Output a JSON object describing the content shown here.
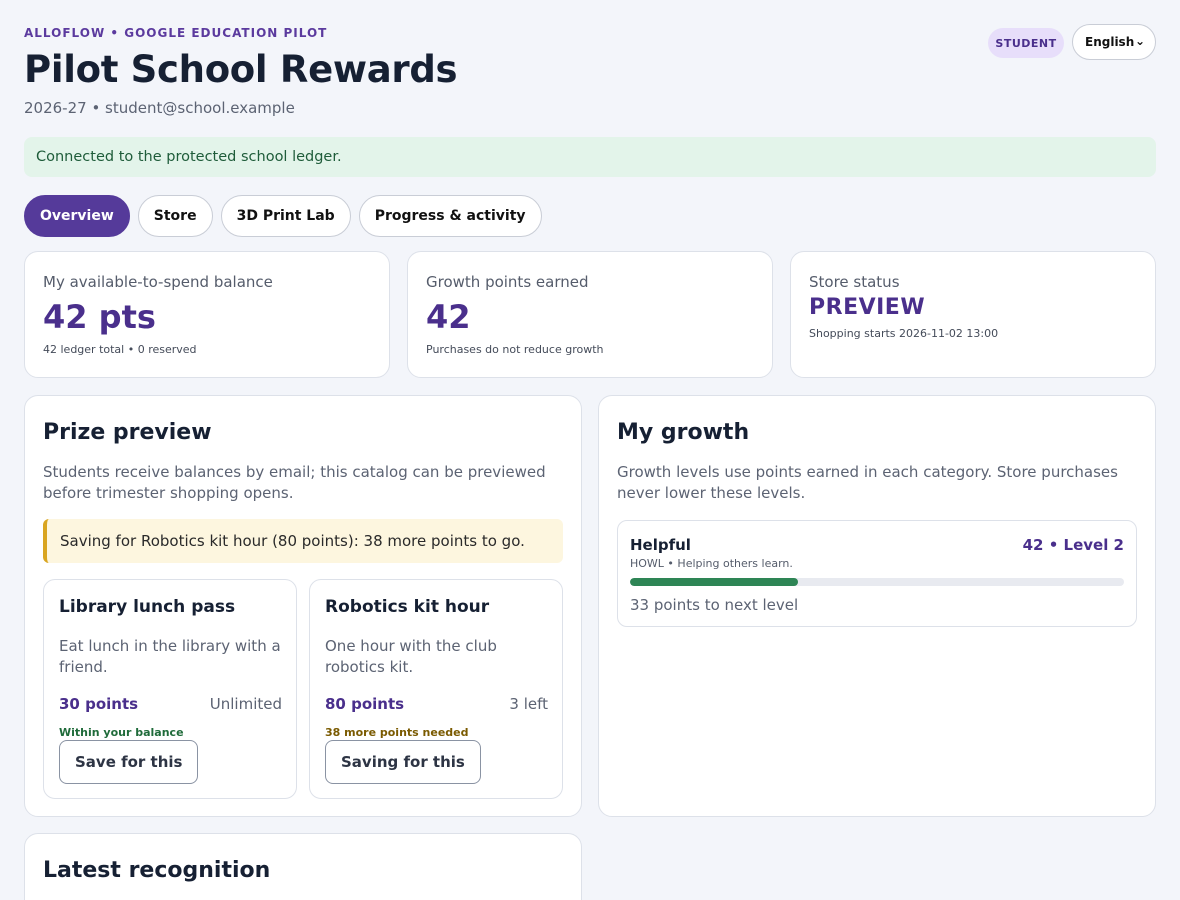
{
  "header": {
    "eyebrow": "ALLOFLOW • GOOGLE EDUCATION PILOT",
    "title": "Pilot School Rewards",
    "subtitle": "2026-27 • student@school.example",
    "role_badge": "STUDENT",
    "language": "English"
  },
  "notice": "Connected to the protected school ledger.",
  "tabs": [
    {
      "label": "Overview",
      "active": true
    },
    {
      "label": "Store",
      "active": false
    },
    {
      "label": "3D Print Lab",
      "active": false
    },
    {
      "label": "Progress & activity",
      "active": false
    }
  ],
  "stats": {
    "balance": {
      "label": "My available-to-spend balance",
      "value": "42 pts",
      "note": "42 ledger total • 0 reserved"
    },
    "growth": {
      "label": "Growth points earned",
      "value": "42",
      "note": "Purchases do not reduce growth"
    },
    "store": {
      "label": "Store status",
      "value": "PREVIEW",
      "note": "Shopping starts 2026-11-02 13:00"
    }
  },
  "prize_preview": {
    "title": "Prize preview",
    "description": "Students receive balances by email; this catalog can be previewed before trimester shopping opens.",
    "saving_goal": "Saving for Robotics kit hour (80 points): 38 more points to go.",
    "prizes": [
      {
        "name": "Library lunch pass",
        "description": "Eat lunch in the library with a friend.",
        "cost": "30 points",
        "stock": "Unlimited",
        "status": "Within your balance",
        "button": "Save for this"
      },
      {
        "name": "Robotics kit hour",
        "description": "One hour with the club robotics kit.",
        "cost": "80 points",
        "stock": "3 left",
        "status": "38 more points needed",
        "button": "Saving for this"
      }
    ]
  },
  "growth": {
    "title": "My growth",
    "description": "Growth levels use points earned in each category. Store purchases never lower these levels.",
    "items": [
      {
        "name": "Helpful",
        "subtitle": "HOWL • Helping others learn.",
        "level": "42 • Level 2",
        "progress_fraction": 0.34,
        "next": "33 points to next level"
      }
    ]
  },
  "recognition": {
    "title": "Latest recognition"
  },
  "colors": {
    "accent": "#553a9a",
    "success": "#2e8555",
    "warning": "#d9a520",
    "background": "#f3f5fa"
  }
}
